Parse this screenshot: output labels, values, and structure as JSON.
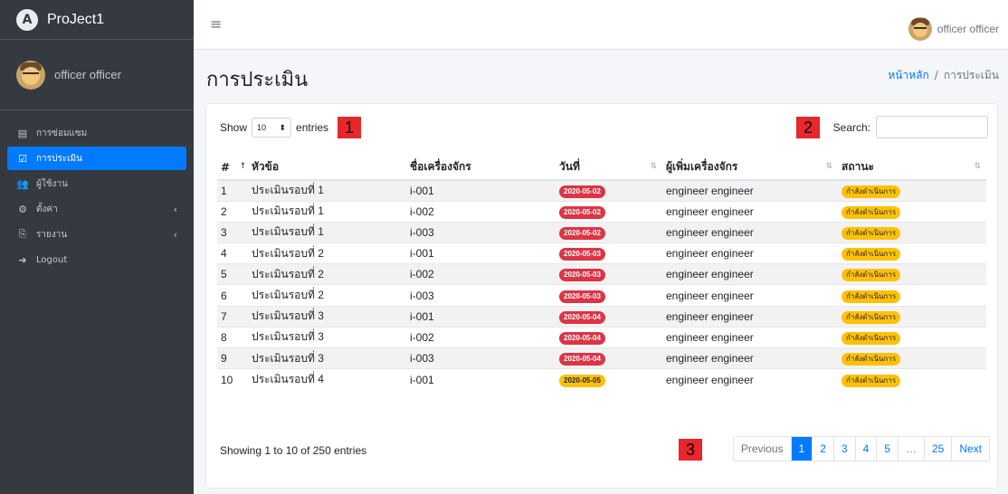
{
  "brand": {
    "logo_letter": "A",
    "name": "ProJect1"
  },
  "user": {
    "name": "officer officer"
  },
  "sidebar": {
    "items": [
      {
        "label": "การซ่อมแซม",
        "icon": "clipboard-icon",
        "glyph": "▤"
      },
      {
        "label": "การประเมิน",
        "icon": "check-square-icon",
        "glyph": "☑",
        "active": true
      },
      {
        "label": "ผู้ใช้งาน",
        "icon": "users-icon",
        "glyph": "👥"
      },
      {
        "label": "ตั้งค่า",
        "icon": "gear-icon",
        "glyph": "⚙",
        "arrow": "‹"
      },
      {
        "label": "รายงาน",
        "icon": "pdf-file-icon",
        "glyph": "⎘",
        "arrow": "‹"
      },
      {
        "label": "Logout",
        "icon": "sign-out-icon",
        "glyph": "➜"
      }
    ]
  },
  "header": {
    "menu_glyph": "≡"
  },
  "page": {
    "title": "การประเมิน"
  },
  "breadcrumb": {
    "home": "หน้าหลัก",
    "separator": "/",
    "current": "การประเมิน"
  },
  "table_controls": {
    "show_label": "Show",
    "entries_value": "10",
    "select_glyph": "⬍",
    "entries_label": "entries",
    "search_label": "Search:"
  },
  "markers": {
    "m1": "1",
    "m2": "2",
    "m3": "3"
  },
  "table": {
    "columns": [
      "#",
      "หัวข้อ",
      "ชื่อเครื่องจักร",
      "วันที่",
      "ผู้เพิ่มเครื่องจักร",
      "สถานะ"
    ],
    "sort_glyphs": {
      "active": "↑",
      "idle": "⇅"
    },
    "rows": [
      {
        "no": "1",
        "topic": "ประเมินรอบที่ 1",
        "machine": "i-001",
        "date": "2020-05-02",
        "date_color": "red",
        "added_by": "engineer engineer",
        "status": "กำลังดำเนินการ"
      },
      {
        "no": "2",
        "topic": "ประเมินรอบที่ 1",
        "machine": "i-002",
        "date": "2020-05-02",
        "date_color": "red",
        "added_by": "engineer engineer",
        "status": "กำลังดำเนินการ"
      },
      {
        "no": "3",
        "topic": "ประเมินรอบที่ 1",
        "machine": "i-003",
        "date": "2020-05-02",
        "date_color": "red",
        "added_by": "engineer engineer",
        "status": "กำลังดำเนินการ"
      },
      {
        "no": "4",
        "topic": "ประเมินรอบที่ 2",
        "machine": "i-001",
        "date": "2020-05-03",
        "date_color": "red",
        "added_by": "engineer engineer",
        "status": "กำลังดำเนินการ"
      },
      {
        "no": "5",
        "topic": "ประเมินรอบที่ 2",
        "machine": "i-002",
        "date": "2020-05-03",
        "date_color": "red",
        "added_by": "engineer engineer",
        "status": "กำลังดำเนินการ"
      },
      {
        "no": "6",
        "topic": "ประเมินรอบที่ 2",
        "machine": "i-003",
        "date": "2020-05-03",
        "date_color": "red",
        "added_by": "engineer engineer",
        "status": "กำลังดำเนินการ"
      },
      {
        "no": "7",
        "topic": "ประเมินรอบที่ 3",
        "machine": "i-001",
        "date": "2020-05-04",
        "date_color": "red",
        "added_by": "engineer engineer",
        "status": "กำลังดำเนินการ"
      },
      {
        "no": "8",
        "topic": "ประเมินรอบที่ 3",
        "machine": "i-002",
        "date": "2020-05-04",
        "date_color": "red",
        "added_by": "engineer engineer",
        "status": "กำลังดำเนินการ"
      },
      {
        "no": "9",
        "topic": "ประเมินรอบที่ 3",
        "machine": "i-003",
        "date": "2020-05-04",
        "date_color": "red",
        "added_by": "engineer engineer",
        "status": "กำลังดำเนินการ"
      },
      {
        "no": "10",
        "topic": "ประเมินรอบที่ 4",
        "machine": "i-001",
        "date": "2020-05-05",
        "date_color": "yellow",
        "added_by": "engineer engineer",
        "status": "กำลังดำเนินการ"
      }
    ]
  },
  "footer": {
    "info": "Showing 1 to 10 of 250 entries"
  },
  "pagination": {
    "items": [
      {
        "label": "Previous",
        "kind": "prev"
      },
      {
        "label": "1",
        "kind": "active"
      },
      {
        "label": "2",
        "kind": "page"
      },
      {
        "label": "3",
        "kind": "page"
      },
      {
        "label": "4",
        "kind": "page"
      },
      {
        "label": "5",
        "kind": "page"
      },
      {
        "label": "…",
        "kind": "ellipsis"
      },
      {
        "label": "25",
        "kind": "page"
      },
      {
        "label": "Next",
        "kind": "next"
      }
    ]
  },
  "colors": {
    "sidebar_bg": "#343a40",
    "accent": "#007bff",
    "badge_red": "#dc3545",
    "badge_yellow": "#ffc107",
    "marker": "#e8262b"
  }
}
